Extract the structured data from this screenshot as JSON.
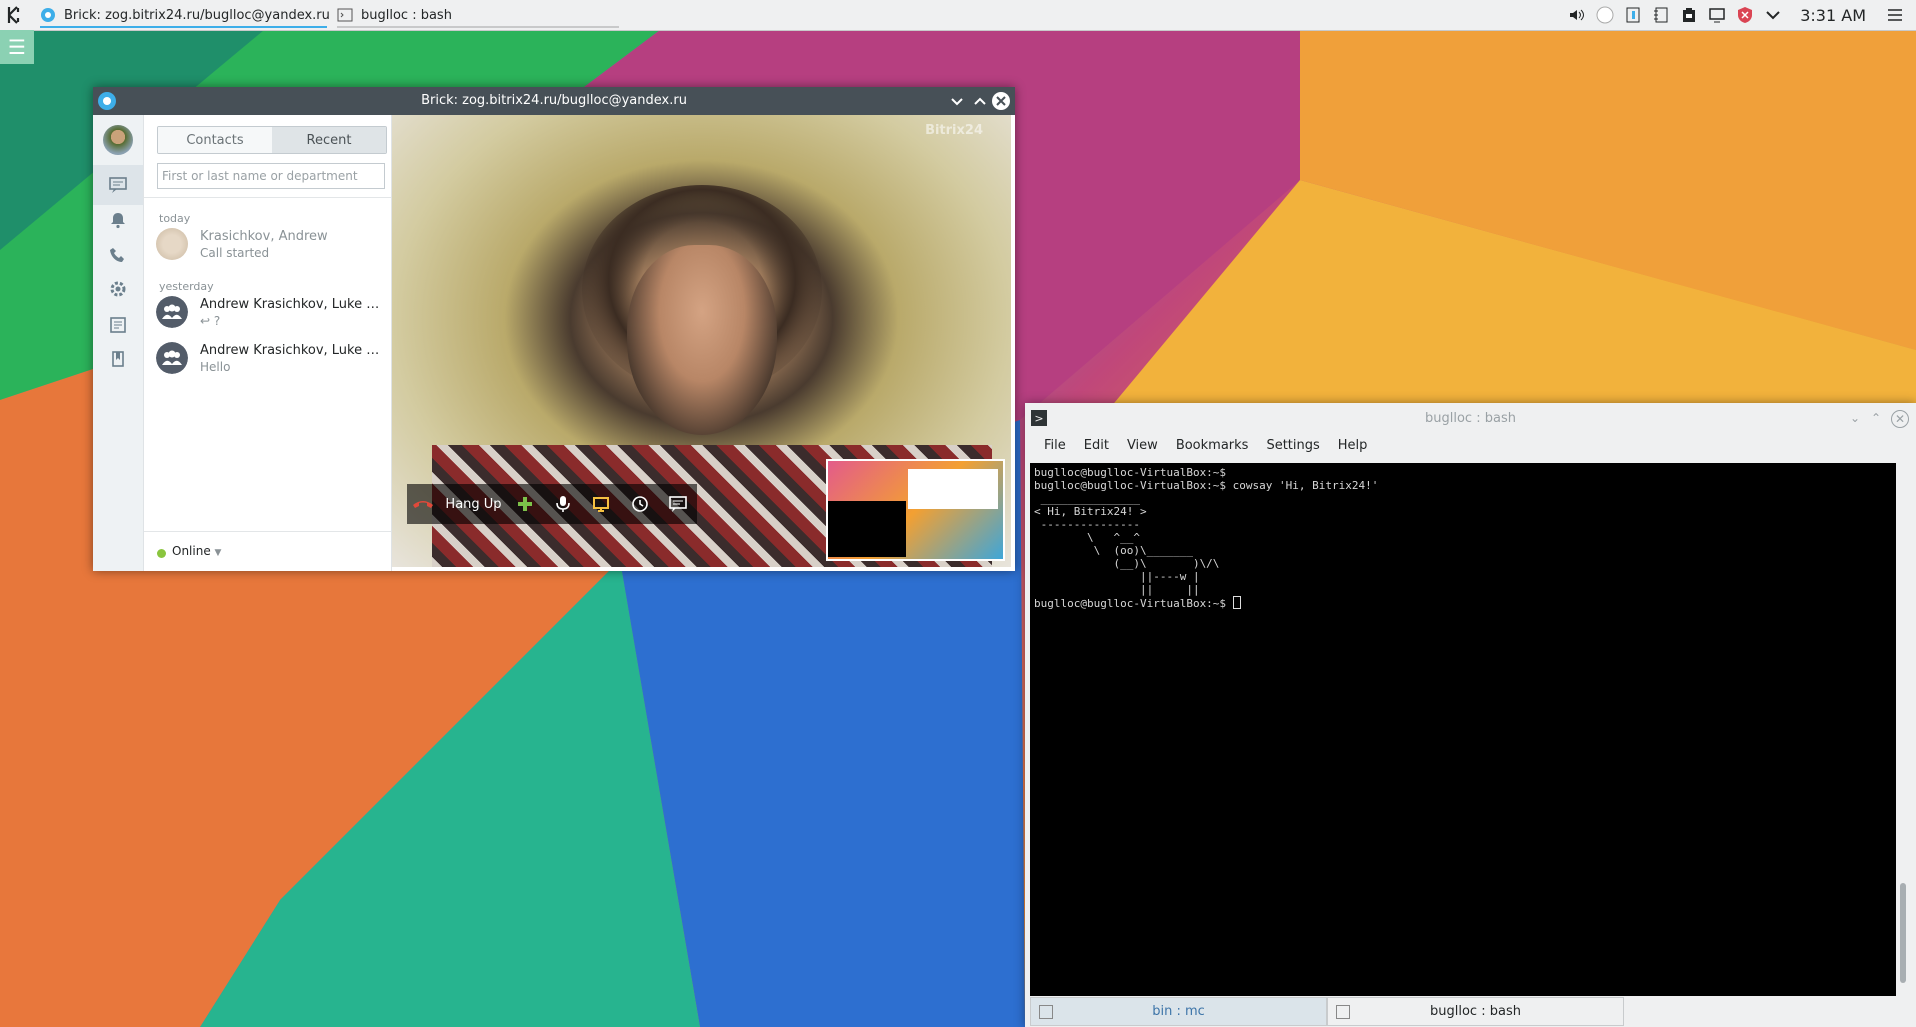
{
  "taskbar": {
    "tasks": [
      {
        "label": "Brick: zog.bitrix24.ru/buglloc@yandex.ru",
        "active": true
      },
      {
        "label": "buglloc : bash",
        "active": false
      }
    ],
    "clock": "3:31 AM",
    "tray_icons": [
      "volume-icon",
      "network-icon",
      "clipboard-icon",
      "notes-icon",
      "battery-icon",
      "display-icon",
      "updates-icon",
      "expand-tray-icon"
    ]
  },
  "bitrix": {
    "window_title": "Brick: zog.bitrix24.ru/buglloc@yandex.ru",
    "tabs": {
      "contacts": "Contacts",
      "recent": "Recent"
    },
    "search": {
      "placeholder": "First or last name or department"
    },
    "groups": {
      "today": "today",
      "yesterday": "yesterday"
    },
    "items": [
      {
        "name": "Krasichkov, Andrew",
        "sub": "Call started"
      },
      {
        "name": "Andrew Krasichkov, Luke Sky...",
        "sub": "↩ ?"
      },
      {
        "name": "Andrew Krasichkov, Luke Sky...",
        "sub": "Hello"
      }
    ],
    "status": "Online",
    "watermark": "Bitrix24",
    "callbar": {
      "hangup": "Hang Up"
    }
  },
  "konsole": {
    "window_title": "buglloc : bash",
    "menu": [
      "File",
      "Edit",
      "View",
      "Bookmarks",
      "Settings",
      "Help"
    ],
    "terminal_lines": [
      "buglloc@buglloc-VirtualBox:~$",
      "buglloc@buglloc-VirtualBox:~$ cowsay 'Hi, Bitrix24!'",
      " _______________",
      "< Hi, Bitrix24! >",
      " ---------------",
      "        \\   ^__^",
      "         \\  (oo)\\_______",
      "            (__)\\       )\\/\\",
      "                ||----w |",
      "                ||     ||",
      "buglloc@buglloc-VirtualBox:~$ "
    ],
    "tabs": [
      {
        "label": "bin : mc",
        "selected": true
      },
      {
        "label": "buglloc : bash",
        "selected": false
      }
    ]
  },
  "colors": {
    "accent": "#3daee9",
    "online": "#8ac53e",
    "hangup": "#e0493a",
    "titlebar": "#475057"
  }
}
